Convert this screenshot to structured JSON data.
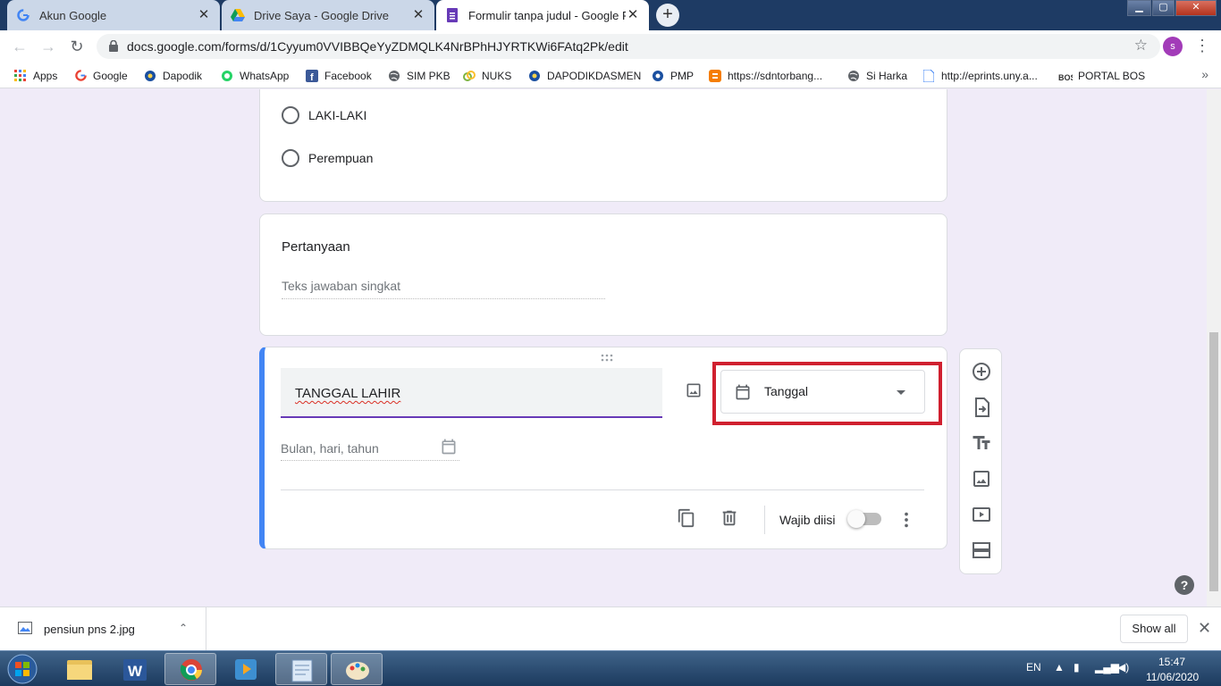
{
  "browser": {
    "tabs": [
      {
        "title": "Akun Google",
        "close": "✕",
        "favicon": "google-g-icon"
      },
      {
        "title": "Drive Saya - Google Drive",
        "close": "✕",
        "favicon": "google-drive-icon"
      },
      {
        "title": "Formulir tanpa judul - Google Fo",
        "close": "✕",
        "favicon": "google-forms-icon"
      }
    ],
    "new_tab": "+",
    "window_controls": {
      "minimize": "▁",
      "maximize": "▢",
      "close": "✕"
    },
    "url": "docs.google.com/forms/d/1Cyyum0VVIBBQeYyZDMQLK4NrBPhHJYRTKWi6FAtq2Pk/edit",
    "avatar_letter": "s",
    "nav": {
      "back": "←",
      "forward": "→",
      "reload": "↻",
      "star": "☆",
      "menu": "⋮"
    }
  },
  "bookmarks": [
    {
      "label": "Apps",
      "icon": "apps-grid-icon"
    },
    {
      "label": "Google",
      "icon": "google-g-icon"
    },
    {
      "label": "Dapodik",
      "icon": "dapodik-icon"
    },
    {
      "label": "WhatsApp",
      "icon": "whatsapp-icon"
    },
    {
      "label": "Facebook",
      "icon": "facebook-icon"
    },
    {
      "label": "SIM PKB",
      "icon": "globe-icon"
    },
    {
      "label": "NUKS",
      "icon": "nuks-icon"
    },
    {
      "label": "DAPODIKDASMEN",
      "icon": "dapodik-icon"
    },
    {
      "label": "PMP",
      "icon": "pmp-icon"
    },
    {
      "label": "https://sdntorbang...",
      "icon": "blogger-icon"
    },
    {
      "label": "Si Harka",
      "icon": "globe-icon"
    },
    {
      "label": "http://eprints.uny.a...",
      "icon": "document-icon"
    },
    {
      "label": "PORTAL BOS",
      "icon": "bos-icon"
    }
  ],
  "bookmarks_more": "»",
  "form": {
    "gender_options": [
      "LAKI-LAKI",
      "Perempuan"
    ],
    "short_question": {
      "title": "Pertanyaan",
      "placeholder": "Teks jawaban singkat"
    },
    "active_question": {
      "title": "TANGGAL LAHIR",
      "type_label": "Tanggal",
      "date_placeholder": "Bulan, hari, tahun",
      "required_label": "Wajib diisi",
      "required": false
    }
  },
  "side_toolbar": [
    "add-question-icon",
    "import-questions-icon",
    "add-title-icon",
    "add-image-icon",
    "add-video-icon",
    "add-section-icon"
  ],
  "help": "?",
  "downloads": {
    "file": "pensiun pns 2.jpg",
    "show_all": "Show all",
    "close": "✕",
    "caret": "⌃"
  },
  "taskbar": {
    "apps": [
      "windows-explorer-icon",
      "word-icon",
      "chrome-icon",
      "media-player-icon",
      "notepad-icon",
      "paint-icon"
    ],
    "language": "EN",
    "time": "15:47",
    "date": "11/06/2020"
  },
  "colors": {
    "form_background": "#f0ebf8",
    "active_card_accent": "#4285f4",
    "focus_underline": "#673ab7",
    "highlight_box": "#d0202f",
    "tab_strip": "#1e3b64"
  }
}
